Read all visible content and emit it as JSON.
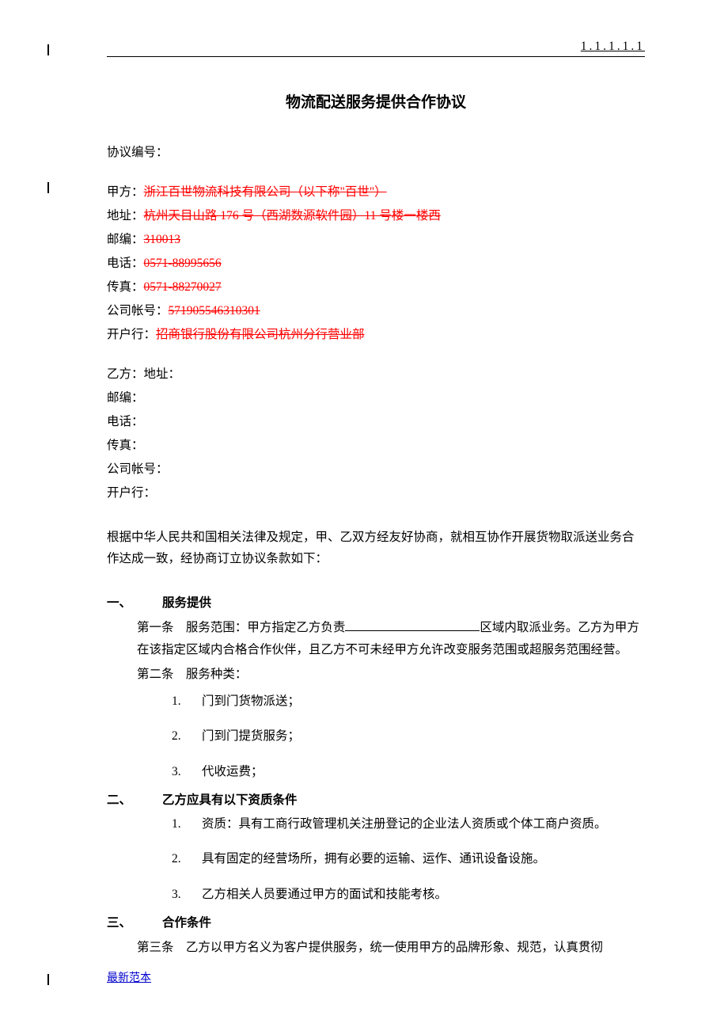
{
  "header": {
    "page_number": "1.1.1.1.1"
  },
  "title": "物流配送服务提供合作协议",
  "agreement_no_label": "协议编号：",
  "party_a": {
    "label": "甲方：",
    "name": "浙江百世物流科技有限公司（以下称\"百世\"）",
    "addr_label": "地址：",
    "addr": "杭州天目山路 176 号（西湖数源软件园）11 号楼一楼西",
    "zip_label": "邮编：",
    "zip": "310013",
    "tel_label": "电话：",
    "tel": "0571-88995656",
    "fax_label": "传真：",
    "fax": "0571-88270027",
    "acct_label": "公司帐号：",
    "acct": "571905546310301",
    "bank_label": "开户行：",
    "bank": "招商银行股份有限公司杭州分行营业部"
  },
  "party_b": {
    "label": "乙方：地址：",
    "zip_label": "邮编：",
    "tel_label": "电话：",
    "fax_label": "传真：",
    "acct_label": "公司帐号：",
    "bank_label": "开户行："
  },
  "preamble": "根据中华人民共和国相关法律及规定，甲、乙双方经友好协商，就相互协作开展货物取派送业务合作达成一致，经协商订立协议条款如下：",
  "sections": {
    "s1": {
      "num": "一、",
      "title": "服务提供"
    },
    "s2": {
      "num": "二、",
      "title": "乙方应具有以下资质条件"
    },
    "s3": {
      "num": "三、",
      "title": "合作条件"
    }
  },
  "clauses": {
    "c1_label": "第一条",
    "c1a": "服务范围：甲方指定乙方负责",
    "c1b": "区域内取派业务。乙方为甲方在该指定区域内合格合作伙伴，且乙方不可未经甲方允许改变服务范围或超服务范围经营。",
    "c2_label": "第二条",
    "c2_text": "服务种类：",
    "c3_label": "第三条",
    "c3_text": "乙方以甲方名义为客户提供服务，统一使用甲方的品牌形象、规范，认真贯彻"
  },
  "s1_items": {
    "i1": "门到门货物派送；",
    "i2": "门到门提货服务；",
    "i3": "代收运费；"
  },
  "s2_items": {
    "i1": "资质：具有工商行政管理机关注册登记的企业法人资质或个体工商户资质。",
    "i2": "具有固定的经营场所，拥有必要的运输、运作、通讯设备设施。",
    "i3": "乙方相关人员要通过甲方的面试和技能考核。"
  },
  "num_labels": {
    "n1": "1.",
    "n2": "2.",
    "n3": "3."
  },
  "footer": {
    "link": "最新范本"
  }
}
